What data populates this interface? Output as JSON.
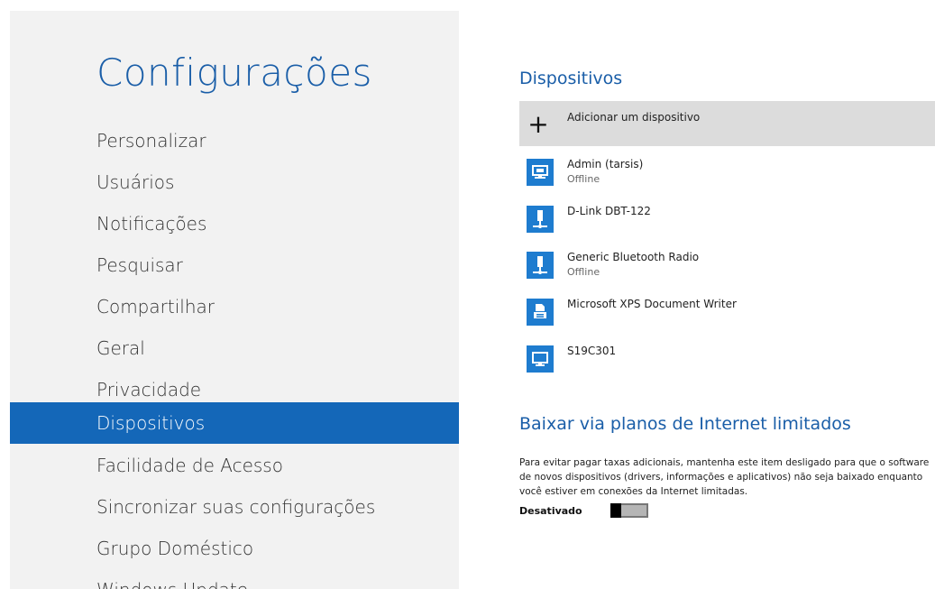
{
  "sidebar": {
    "title": "Configurações",
    "items": [
      {
        "label": "Personalizar"
      },
      {
        "label": "Usuários"
      },
      {
        "label": "Notificações"
      },
      {
        "label": "Pesquisar"
      },
      {
        "label": "Compartilhar"
      },
      {
        "label": "Geral"
      },
      {
        "label": "Privacidade"
      },
      {
        "label": "Dispositivos",
        "selected": true
      },
      {
        "label": "Facilidade de Acesso"
      },
      {
        "label": "Sincronizar suas configurações"
      },
      {
        "label": "Grupo Doméstico"
      },
      {
        "label": "Windows Update"
      }
    ]
  },
  "devices": {
    "title": "Dispositivos",
    "add_label": "Adicionar um dispositivo",
    "items": [
      {
        "name": "Admin (tarsis)",
        "status": "Offline",
        "icon": "computer-icon"
      },
      {
        "name": "D-Link DBT-122",
        "status": "",
        "icon": "bluetooth-adapter-icon"
      },
      {
        "name": "Generic Bluetooth Radio",
        "status": "Offline",
        "icon": "bluetooth-adapter-icon"
      },
      {
        "name": "Microsoft XPS Document Writer",
        "status": "",
        "icon": "printer-icon"
      },
      {
        "name": "S19C301",
        "status": "",
        "icon": "monitor-icon"
      }
    ]
  },
  "metered": {
    "title": "Baixar via planos de Internet limitados",
    "description": "Para evitar pagar taxas adicionais, mantenha este item desligado para que o software de novos dispositivos (drivers, informações e aplicativos) não seja baixado enquanto você estiver em conexões da Internet limitadas.",
    "toggle_label": "Desativado",
    "toggle_on": false
  },
  "colors": {
    "accent": "#1467b8",
    "title": "#1a5ea8",
    "sidebar_bg": "#f2f2f2",
    "device_icon_bg": "#1e7ccf"
  }
}
